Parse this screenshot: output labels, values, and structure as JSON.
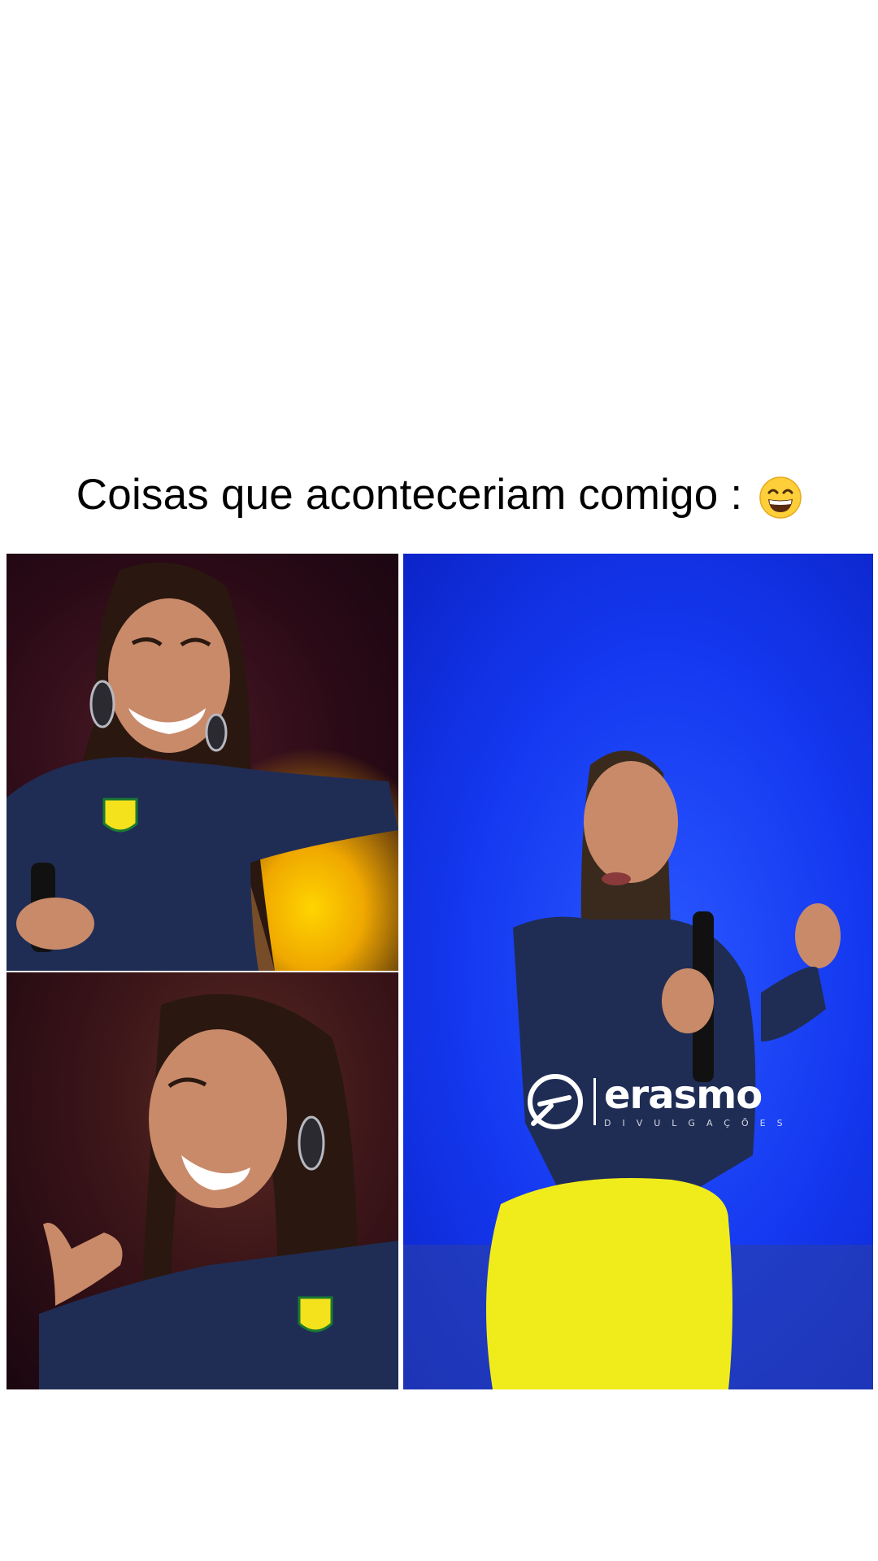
{
  "caption": {
    "text": "Coisas que aconteceriam comigo :",
    "emoji_icon": "grinning-face-with-smiling-eyes-icon"
  },
  "photos": {
    "top_left": {
      "description_icon": "singer-laughing-photo"
    },
    "bottom_left": {
      "description_icon": "singer-smiling-photo"
    },
    "right": {
      "description_icon": "singer-performing-photo"
    }
  },
  "watermark": {
    "brand": "erasmo",
    "subtitle": "DIVULGAÇÕES"
  },
  "colors": {
    "background": "#ffffff",
    "stage_blue": "#1438f0",
    "outfit_navy": "#1f2d55",
    "pants_yellow": "#f0ec1c"
  }
}
